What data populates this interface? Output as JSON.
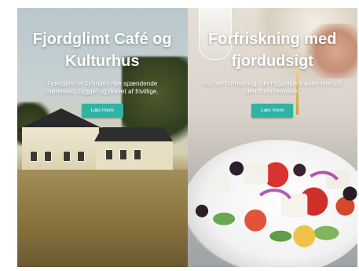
{
  "panels": [
    {
      "title": "Fjordglimt Café og Kulturhus",
      "description": "Fjordglimt er Jyllinges nye spændende mødested, bygget og drevet af frivillige.",
      "button_label": "Læs mere"
    },
    {
      "title": "Forfriskning med fjordudsigt",
      "description": "Nyd en forfriskning i de hyggelige lokaler eller på den flotte terrasse.",
      "button_label": "Læs mere"
    }
  ],
  "colors": {
    "accent": "#2fb3a3",
    "text": "#ffffff"
  }
}
